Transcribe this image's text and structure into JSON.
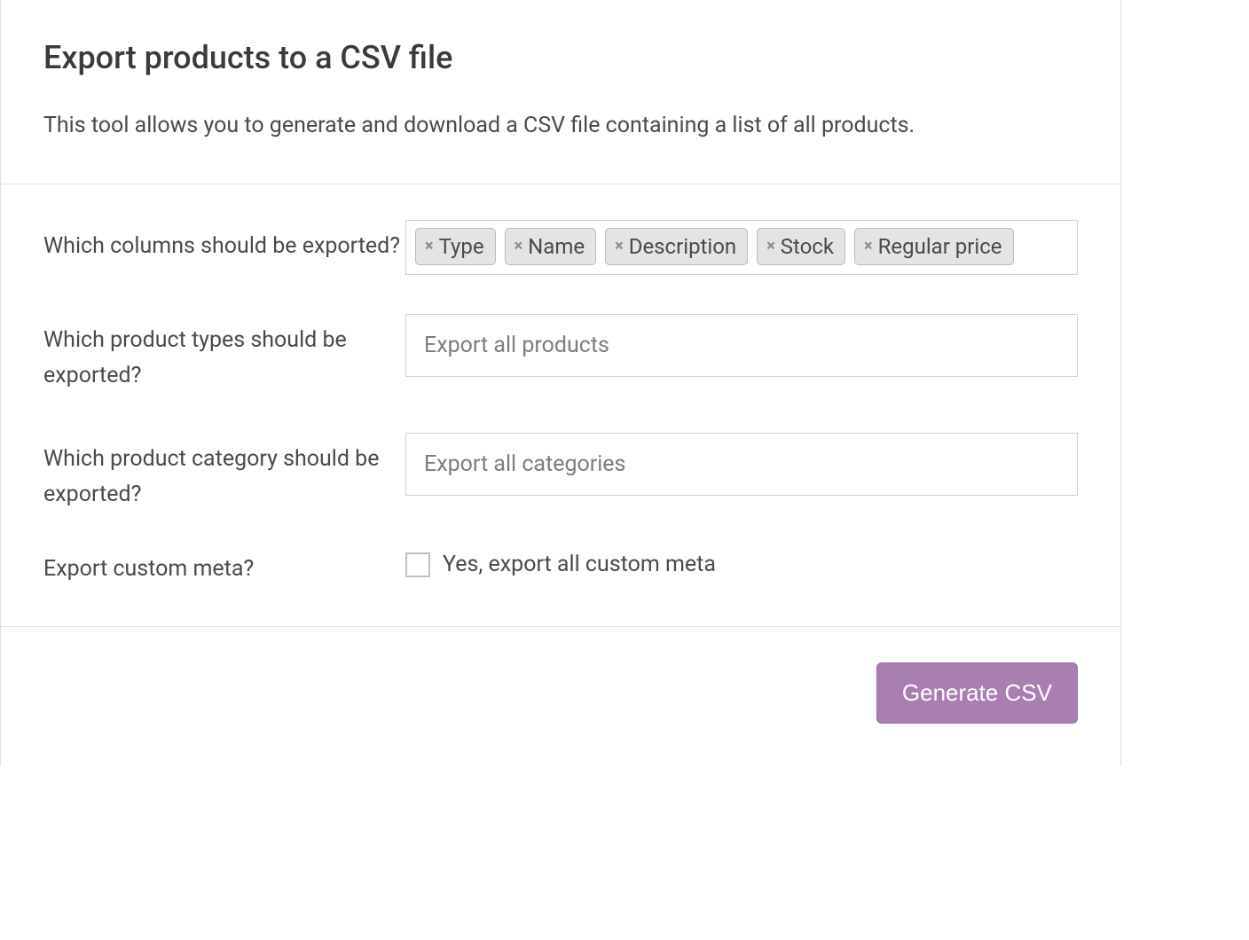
{
  "header": {
    "title": "Export products to a CSV file",
    "description": "This tool allows you to generate and download a CSV file containing a list of all products."
  },
  "form": {
    "columns": {
      "label": "Which columns should be exported?",
      "tags": [
        "Type",
        "Name",
        "Description",
        "Stock",
        "Regular price"
      ]
    },
    "product_types": {
      "label": "Which product types should be exported?",
      "placeholder": "Export all products"
    },
    "product_category": {
      "label": "Which product category should be exported?",
      "placeholder": "Export all categories"
    },
    "custom_meta": {
      "label": "Export custom meta?",
      "checkbox_label": "Yes, export all custom meta",
      "checked": false
    }
  },
  "footer": {
    "generate_button": "Generate CSV"
  }
}
